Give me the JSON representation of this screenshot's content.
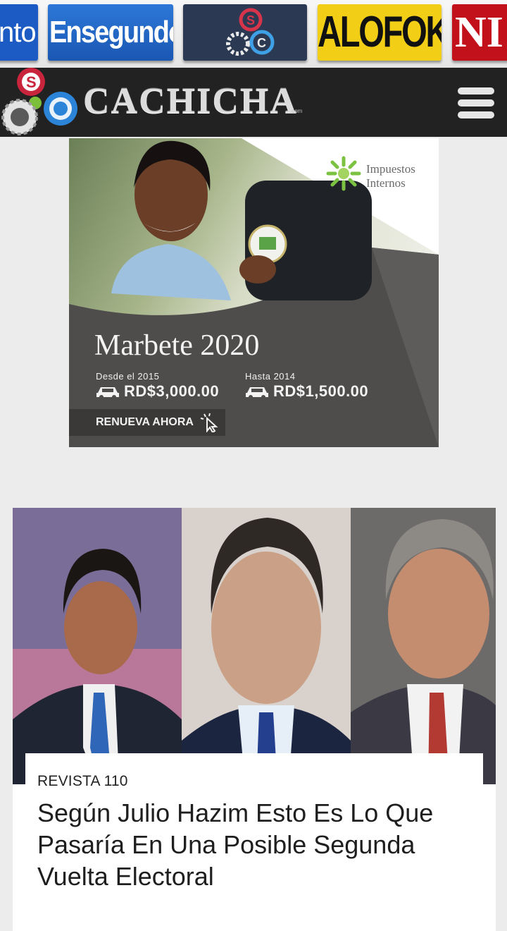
{
  "partner_strip": {
    "items": [
      {
        "name": "partner-logo-1",
        "text": "nto"
      },
      {
        "name": "partner-logo-ensegundos",
        "text": "Ensegundos"
      },
      {
        "name": "partner-logo-3",
        "text": ""
      },
      {
        "name": "partner-logo-alofoke",
        "text": "ALOFOKE"
      },
      {
        "name": "partner-logo-5",
        "text": "NI"
      }
    ]
  },
  "header": {
    "site_name": "CACHICHA",
    "site_suffix": ".com",
    "menu_icon": "hamburger-menu-icon"
  },
  "ad": {
    "brand": "Impuestos Internos",
    "title": "Marbete 2020",
    "price_left_label": "Desde el 2015",
    "price_left": "RD$3,000.00",
    "price_right_label": "Hasta 2014",
    "price_right": "RD$1,500.00",
    "cta": "RENUEVA AHORA",
    "colors": {
      "panel": "#4e4d4c",
      "accent_green": "#7cc242"
    }
  },
  "article": {
    "category": "REVISTA 110",
    "title": "Según Julio Hazim Esto Es Lo Que Pasaría En Una Posible Segunda Vuelta Electoral"
  }
}
